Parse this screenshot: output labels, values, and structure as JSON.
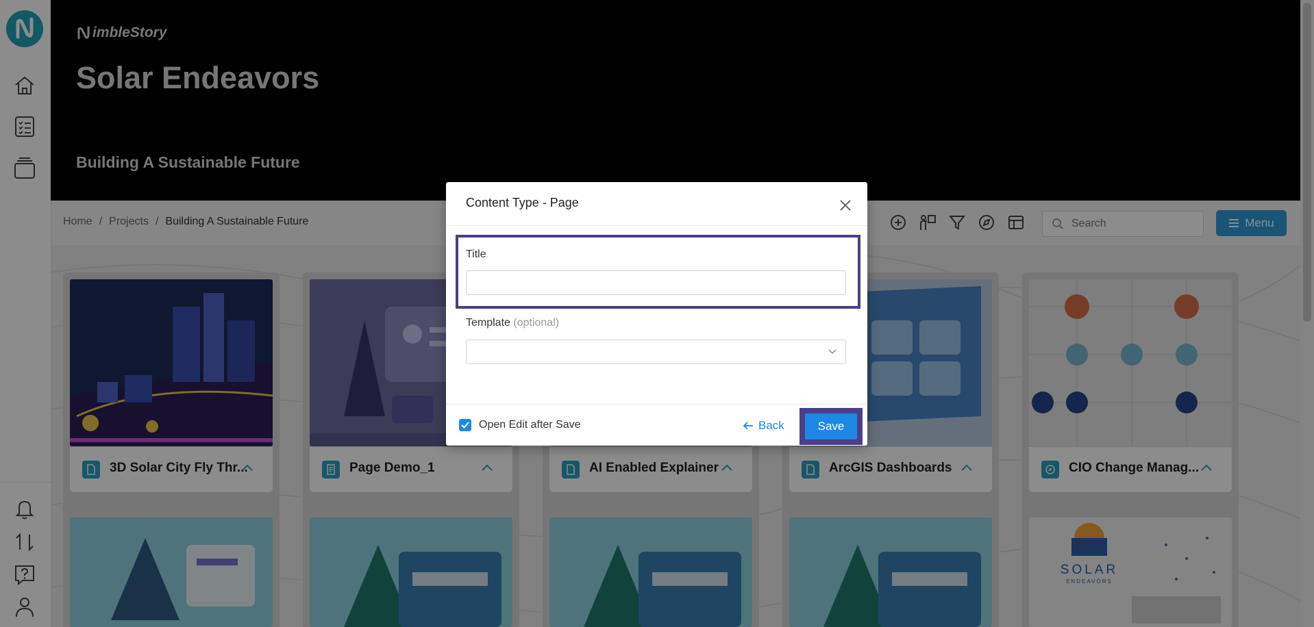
{
  "app": {
    "brand": "NimbleStory",
    "brand_rest": "imbleStory"
  },
  "hero": {
    "title": "Solar Endeavors",
    "subtitle": "Building A Sustainable Future"
  },
  "breadcrumb": {
    "items": [
      "Home",
      "Projects"
    ],
    "separator": "/",
    "current": "Building A Sustainable Future"
  },
  "toolbar": {
    "icons": [
      "add-circle-icon",
      "presenter-icon",
      "filter-icon",
      "compass-icon",
      "layout-icon"
    ],
    "search_placeholder": "Search",
    "menu_label": "Menu"
  },
  "rail": {
    "top_icons": [
      "home-icon",
      "checklist-icon",
      "stack-icon"
    ],
    "bottom_icons": [
      "bell-icon",
      "swap-icon",
      "help-icon",
      "user-icon"
    ]
  },
  "cards": [
    {
      "label": "3D Solar City Fly Thr...",
      "type": "document"
    },
    {
      "label": "Page Demo_1",
      "type": "page"
    },
    {
      "label": "AI Enabled Explainer",
      "type": "document"
    },
    {
      "label": "ArcGIS Dashboards",
      "type": "document"
    },
    {
      "label": "CIO Change Manag...",
      "type": "compass"
    }
  ],
  "second_row_card": {
    "logo_text": "SOLAR",
    "logo_sub": "ENDEAVORS"
  },
  "modal": {
    "title": "Content Type - Page",
    "title_label": "Title",
    "title_value": "",
    "template_label": "Template",
    "template_optional": "(optional)",
    "template_value": "",
    "open_edit_label": "Open Edit after Save",
    "open_edit_checked": true,
    "back_label": "Back",
    "save_label": "Save"
  },
  "colors": {
    "accent": "#1e88e5",
    "teal": "#22a3b6",
    "highlight": "#4b3f8a",
    "menu": "#2e9bd9"
  }
}
